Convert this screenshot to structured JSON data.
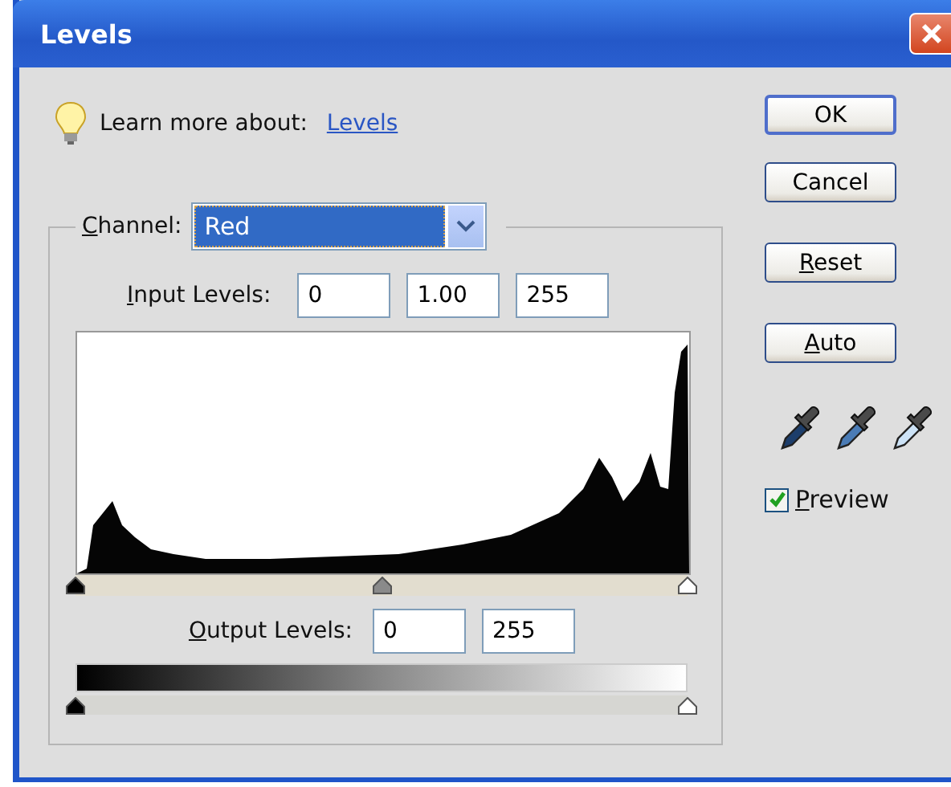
{
  "window": {
    "title": "Levels"
  },
  "learn_more": {
    "label": "Learn more about:",
    "link": "Levels"
  },
  "channel": {
    "label": "Channel:",
    "mnemonic": true,
    "value": "Red"
  },
  "input_levels": {
    "label": "Input Levels:",
    "mnemonic": true,
    "values": [
      "0",
      "1.00",
      "255"
    ],
    "handles": [
      {
        "kind": "shadow",
        "level": 0
      },
      {
        "kind": "midtone",
        "level": 0.5
      },
      {
        "kind": "highlight",
        "level": 1
      }
    ]
  },
  "output_levels": {
    "label": "Output Levels:",
    "mnemonic": true,
    "values": [
      "0",
      "255"
    ],
    "handles": [
      {
        "kind": "shadow",
        "level": 0
      },
      {
        "kind": "highlight",
        "level": 1
      }
    ]
  },
  "buttons": [
    {
      "label": "OK",
      "mnemonic": false,
      "default": true
    },
    {
      "label": "Cancel",
      "mnemonic": false,
      "default": false
    },
    {
      "label": "Reset",
      "mnemonic": true,
      "default": false
    },
    {
      "label": "Auto",
      "mnemonic": true,
      "default": false
    }
  ],
  "preview": {
    "label": "Preview",
    "mnemonic": true,
    "checked": true
  }
}
